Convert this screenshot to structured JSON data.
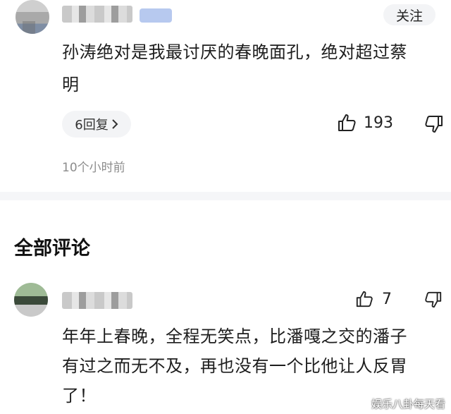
{
  "top_comment": {
    "follow_label": "关注",
    "text_line1": "孙涛绝对是我最讨厌的春晚面孔，绝对超过蔡",
    "text_line2": "明",
    "replies_label": "6回复",
    "like_count": "193",
    "timestamp": "10个小时前"
  },
  "section": {
    "title": "全部评论"
  },
  "second_comment": {
    "like_count": "7",
    "text_line1": "年年上春晚，全程无笑点，比潘嘎之交的潘子",
    "text_line2": "有过之而无不及，再也没有一个比他让人反胃",
    "text_line3": "了！"
  },
  "watermark": "娱乐八卦每天看",
  "icons": {
    "like": "thumbs-up-icon",
    "dislike": "thumbs-down-icon",
    "chevron": "chevron-right-icon"
  }
}
